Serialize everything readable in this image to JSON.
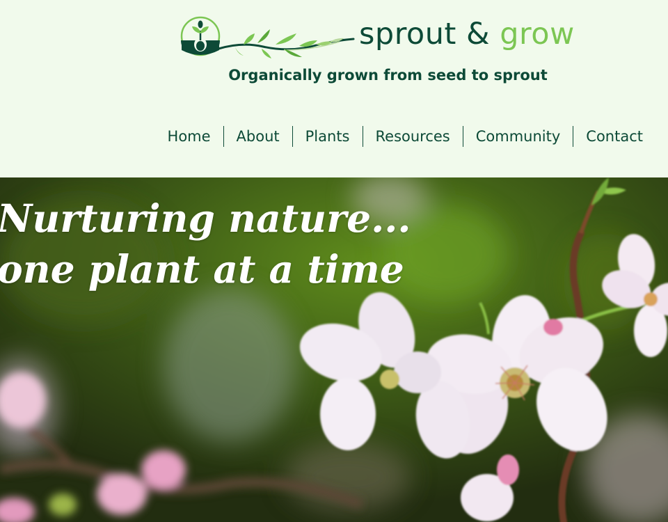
{
  "brand": {
    "name_part1": "sprout",
    "name_part2": "&",
    "name_part3": "grow",
    "tagline": "Organically grown from seed to sprout",
    "logo_icon": "seedling-logo-icon",
    "colors": {
      "dark_green": "#0d4a37",
      "light_green": "#7cc653",
      "background": "#f1faec"
    }
  },
  "nav": {
    "items": [
      {
        "label": "Home"
      },
      {
        "label": "About"
      },
      {
        "label": "Plants"
      },
      {
        "label": "Resources"
      },
      {
        "label": "Community"
      },
      {
        "label": "Contact"
      }
    ]
  },
  "hero": {
    "line1": "Nurturing nature...",
    "line2": "one plant at a time",
    "image": "cherry-blossom-branch-photo"
  }
}
